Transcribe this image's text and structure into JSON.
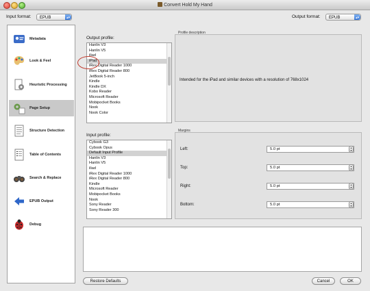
{
  "window": {
    "title": "Convert Hold My Hand"
  },
  "input_format": {
    "label": "Input format:",
    "value": "EPUB"
  },
  "output_format": {
    "label": "Output format:",
    "value": "EPUB"
  },
  "sidebar": {
    "items": [
      {
        "label": "Metadata",
        "icon": "id-card-icon"
      },
      {
        "label": "Look & Feel",
        "icon": "palette-icon"
      },
      {
        "label": "Heuristic Processing",
        "icon": "cog-icon"
      },
      {
        "label": "Page Setup",
        "icon": "page-setup-icon",
        "selected": true
      },
      {
        "label": "Structure Detection",
        "icon": "document-icon"
      },
      {
        "label": "Table of Contents",
        "icon": "list-icon"
      },
      {
        "label": "Search & Replace",
        "icon": "binoculars-icon"
      },
      {
        "label": "EPUB Output",
        "icon": "arrow-icon"
      },
      {
        "label": "Debug",
        "icon": "ladybug-icon"
      }
    ]
  },
  "output_profile": {
    "label": "Output profile:",
    "items": [
      "Hanlin V3",
      "Hanlin V5",
      "iliad",
      "iPad",
      "iRex Digital Reader 1000",
      "iRex Digital Reader 800",
      "JetBook 5-inch",
      "Kindle",
      "Kindle DX",
      "Kobo Reader",
      "Microsoft Reader",
      "Mobipocket Books",
      "Nook",
      "Nook Color"
    ],
    "selected": "iPad"
  },
  "profile_description": {
    "label": "Profile description",
    "text": "Intended for the iPad and similar devices with a resolution of 768x1024"
  },
  "input_profile": {
    "label": "Input profile:",
    "items": [
      "Cybook G3",
      "Cybook Opus",
      "Default Input Profile",
      "Hanlin V3",
      "Hanlin V5",
      "iliad",
      "iRex Digital Reader 1000",
      "iRex Digital Reader 800",
      "Kindle",
      "Microsoft Reader",
      "Mobipocket Books",
      "Nook",
      "Sony Reader",
      "Sony Reader 300"
    ],
    "selected": "Default Input Profile"
  },
  "margins": {
    "label": "Margins",
    "left": {
      "label": "Left:",
      "value": "5.0 pt"
    },
    "top": {
      "label": "Top:",
      "value": "5.0 pt"
    },
    "right": {
      "label": "Right:",
      "value": "5.0 pt"
    },
    "bottom": {
      "label": "Bottom:",
      "value": "5.0 pt"
    }
  },
  "buttons": {
    "restore": "Restore Defaults",
    "cancel": "Cancel",
    "ok": "OK"
  }
}
